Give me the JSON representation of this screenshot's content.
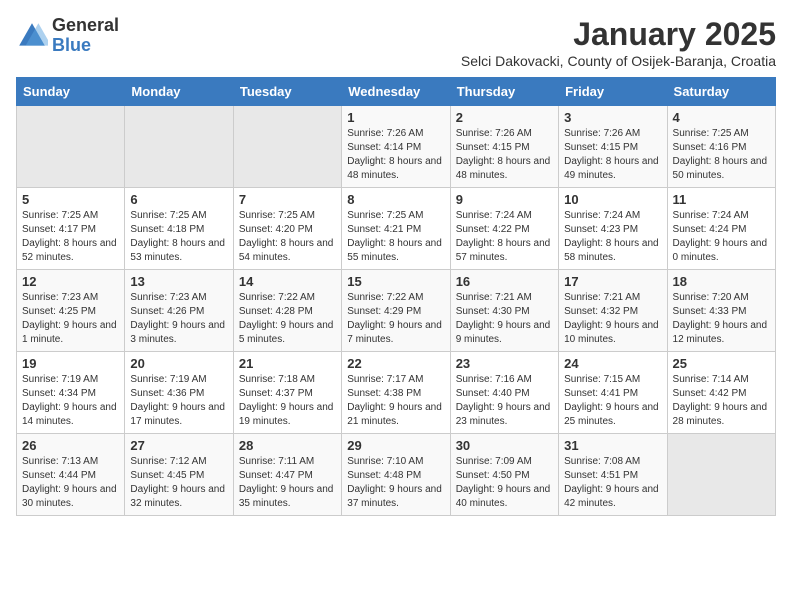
{
  "logo": {
    "general": "General",
    "blue": "Blue"
  },
  "header": {
    "month": "January 2025",
    "subtitle": "Selci Dakovacki, County of Osijek-Baranja, Croatia"
  },
  "weekdays": [
    "Sunday",
    "Monday",
    "Tuesday",
    "Wednesday",
    "Thursday",
    "Friday",
    "Saturday"
  ],
  "weeks": [
    [
      {
        "day": "",
        "info": ""
      },
      {
        "day": "",
        "info": ""
      },
      {
        "day": "",
        "info": ""
      },
      {
        "day": "1",
        "info": "Sunrise: 7:26 AM\nSunset: 4:14 PM\nDaylight: 8 hours and 48 minutes."
      },
      {
        "day": "2",
        "info": "Sunrise: 7:26 AM\nSunset: 4:15 PM\nDaylight: 8 hours and 48 minutes."
      },
      {
        "day": "3",
        "info": "Sunrise: 7:26 AM\nSunset: 4:15 PM\nDaylight: 8 hours and 49 minutes."
      },
      {
        "day": "4",
        "info": "Sunrise: 7:25 AM\nSunset: 4:16 PM\nDaylight: 8 hours and 50 minutes."
      }
    ],
    [
      {
        "day": "5",
        "info": "Sunrise: 7:25 AM\nSunset: 4:17 PM\nDaylight: 8 hours and 52 minutes."
      },
      {
        "day": "6",
        "info": "Sunrise: 7:25 AM\nSunset: 4:18 PM\nDaylight: 8 hours and 53 minutes."
      },
      {
        "day": "7",
        "info": "Sunrise: 7:25 AM\nSunset: 4:20 PM\nDaylight: 8 hours and 54 minutes."
      },
      {
        "day": "8",
        "info": "Sunrise: 7:25 AM\nSunset: 4:21 PM\nDaylight: 8 hours and 55 minutes."
      },
      {
        "day": "9",
        "info": "Sunrise: 7:24 AM\nSunset: 4:22 PM\nDaylight: 8 hours and 57 minutes."
      },
      {
        "day": "10",
        "info": "Sunrise: 7:24 AM\nSunset: 4:23 PM\nDaylight: 8 hours and 58 minutes."
      },
      {
        "day": "11",
        "info": "Sunrise: 7:24 AM\nSunset: 4:24 PM\nDaylight: 9 hours and 0 minutes."
      }
    ],
    [
      {
        "day": "12",
        "info": "Sunrise: 7:23 AM\nSunset: 4:25 PM\nDaylight: 9 hours and 1 minute."
      },
      {
        "day": "13",
        "info": "Sunrise: 7:23 AM\nSunset: 4:26 PM\nDaylight: 9 hours and 3 minutes."
      },
      {
        "day": "14",
        "info": "Sunrise: 7:22 AM\nSunset: 4:28 PM\nDaylight: 9 hours and 5 minutes."
      },
      {
        "day": "15",
        "info": "Sunrise: 7:22 AM\nSunset: 4:29 PM\nDaylight: 9 hours and 7 minutes."
      },
      {
        "day": "16",
        "info": "Sunrise: 7:21 AM\nSunset: 4:30 PM\nDaylight: 9 hours and 9 minutes."
      },
      {
        "day": "17",
        "info": "Sunrise: 7:21 AM\nSunset: 4:32 PM\nDaylight: 9 hours and 10 minutes."
      },
      {
        "day": "18",
        "info": "Sunrise: 7:20 AM\nSunset: 4:33 PM\nDaylight: 9 hours and 12 minutes."
      }
    ],
    [
      {
        "day": "19",
        "info": "Sunrise: 7:19 AM\nSunset: 4:34 PM\nDaylight: 9 hours and 14 minutes."
      },
      {
        "day": "20",
        "info": "Sunrise: 7:19 AM\nSunset: 4:36 PM\nDaylight: 9 hours and 17 minutes."
      },
      {
        "day": "21",
        "info": "Sunrise: 7:18 AM\nSunset: 4:37 PM\nDaylight: 9 hours and 19 minutes."
      },
      {
        "day": "22",
        "info": "Sunrise: 7:17 AM\nSunset: 4:38 PM\nDaylight: 9 hours and 21 minutes."
      },
      {
        "day": "23",
        "info": "Sunrise: 7:16 AM\nSunset: 4:40 PM\nDaylight: 9 hours and 23 minutes."
      },
      {
        "day": "24",
        "info": "Sunrise: 7:15 AM\nSunset: 4:41 PM\nDaylight: 9 hours and 25 minutes."
      },
      {
        "day": "25",
        "info": "Sunrise: 7:14 AM\nSunset: 4:42 PM\nDaylight: 9 hours and 28 minutes."
      }
    ],
    [
      {
        "day": "26",
        "info": "Sunrise: 7:13 AM\nSunset: 4:44 PM\nDaylight: 9 hours and 30 minutes."
      },
      {
        "day": "27",
        "info": "Sunrise: 7:12 AM\nSunset: 4:45 PM\nDaylight: 9 hours and 32 minutes."
      },
      {
        "day": "28",
        "info": "Sunrise: 7:11 AM\nSunset: 4:47 PM\nDaylight: 9 hours and 35 minutes."
      },
      {
        "day": "29",
        "info": "Sunrise: 7:10 AM\nSunset: 4:48 PM\nDaylight: 9 hours and 37 minutes."
      },
      {
        "day": "30",
        "info": "Sunrise: 7:09 AM\nSunset: 4:50 PM\nDaylight: 9 hours and 40 minutes."
      },
      {
        "day": "31",
        "info": "Sunrise: 7:08 AM\nSunset: 4:51 PM\nDaylight: 9 hours and 42 minutes."
      },
      {
        "day": "",
        "info": ""
      }
    ]
  ]
}
